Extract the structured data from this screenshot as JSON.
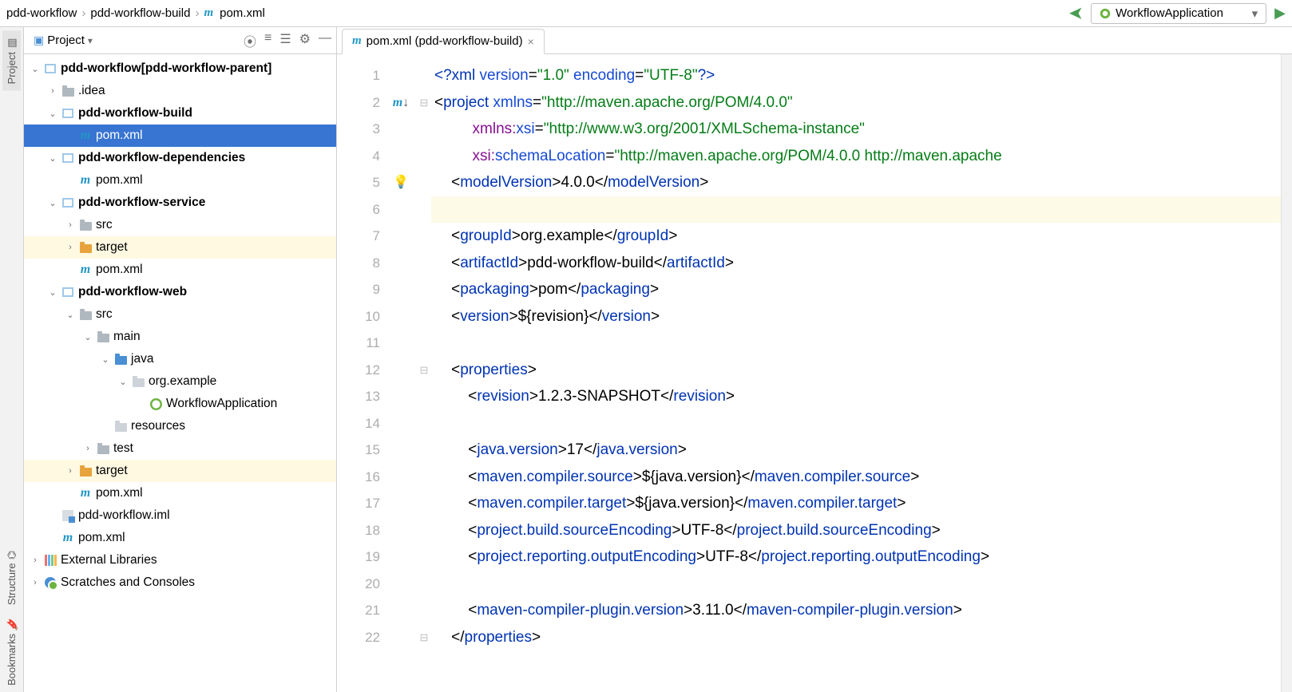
{
  "breadcrumb": [
    "pdd-workflow",
    "pdd-workflow-build",
    "pom.xml"
  ],
  "run_config": "WorkflowApplication",
  "rail": {
    "project": "Project",
    "structure": "Structure",
    "bookmarks": "Bookmarks"
  },
  "project_panel": {
    "title": "Project"
  },
  "tree": [
    {
      "d": 0,
      "tw": "v",
      "ic": "module",
      "label": "pdd-workflow",
      "suffix": " [pdd-workflow-parent]",
      "bold": true
    },
    {
      "d": 1,
      "tw": ">",
      "ic": "folder",
      "label": ".idea"
    },
    {
      "d": 1,
      "tw": "v",
      "ic": "module",
      "label": "pdd-workflow-build",
      "bold": true
    },
    {
      "d": 2,
      "tw": "",
      "ic": "maven",
      "label": "pom.xml",
      "sel": true
    },
    {
      "d": 1,
      "tw": "v",
      "ic": "module",
      "label": "pdd-workflow-dependencies",
      "bold": true
    },
    {
      "d": 2,
      "tw": "",
      "ic": "maven",
      "label": "pom.xml"
    },
    {
      "d": 1,
      "tw": "v",
      "ic": "module",
      "label": "pdd-workflow-service",
      "bold": true
    },
    {
      "d": 2,
      "tw": ">",
      "ic": "folder",
      "label": "src"
    },
    {
      "d": 2,
      "tw": ">",
      "ic": "folder-orange",
      "label": "target",
      "hl": true
    },
    {
      "d": 2,
      "tw": "",
      "ic": "maven",
      "label": "pom.xml"
    },
    {
      "d": 1,
      "tw": "v",
      "ic": "module",
      "label": "pdd-workflow-web",
      "bold": true
    },
    {
      "d": 2,
      "tw": "v",
      "ic": "folder",
      "label": "src"
    },
    {
      "d": 3,
      "tw": "v",
      "ic": "folder",
      "label": "main"
    },
    {
      "d": 4,
      "tw": "v",
      "ic": "folder-blue",
      "label": "java"
    },
    {
      "d": 5,
      "tw": "v",
      "ic": "folder-pkg",
      "label": "org.example"
    },
    {
      "d": 6,
      "tw": "",
      "ic": "java",
      "label": "WorkflowApplication"
    },
    {
      "d": 4,
      "tw": "",
      "ic": "folder-pkg",
      "label": "resources"
    },
    {
      "d": 3,
      "tw": ">",
      "ic": "folder",
      "label": "test"
    },
    {
      "d": 2,
      "tw": ">",
      "ic": "folder-orange",
      "label": "target",
      "hl": true
    },
    {
      "d": 2,
      "tw": "",
      "ic": "maven",
      "label": "pom.xml"
    },
    {
      "d": 1,
      "tw": "",
      "ic": "iml",
      "label": "pdd-workflow.iml"
    },
    {
      "d": 1,
      "tw": "",
      "ic": "maven",
      "label": "pom.xml"
    },
    {
      "d": 0,
      "tw": ">",
      "ic": "lib",
      "label": "External Libraries"
    },
    {
      "d": 0,
      "tw": ">",
      "ic": "scratch",
      "label": "Scratches and Consoles"
    }
  ],
  "tab": "pom.xml (pdd-workflow-build)",
  "lines": 22,
  "gutter_marks": {
    "2": "m↓",
    "5": "bulb"
  },
  "fold_marks": {
    "2": "⊟",
    "12": "⊟",
    "22": "⊟"
  },
  "code": [
    [
      [
        "pi",
        "<?"
      ],
      [
        "tag",
        "xml "
      ],
      [
        "attr",
        "version"
      ],
      [
        "punc",
        "="
      ],
      [
        "str",
        "\"1.0\""
      ],
      [
        "attr",
        " encoding"
      ],
      [
        "punc",
        "="
      ],
      [
        "str",
        "\"UTF-8\""
      ],
      [
        "pi",
        "?>"
      ]
    ],
    [
      [
        "punc",
        "<"
      ],
      [
        "tag",
        "project "
      ],
      [
        "attr",
        "xmlns"
      ],
      [
        "punc",
        "="
      ],
      [
        "str",
        "\"http://maven.apache.org/POM/4.0.0\""
      ]
    ],
    [
      [
        "text",
        "         "
      ],
      [
        "ns",
        "xmlns:"
      ],
      [
        "attr",
        "xsi"
      ],
      [
        "punc",
        "="
      ],
      [
        "str",
        "\"http://www.w3.org/2001/XMLSchema-instance\""
      ]
    ],
    [
      [
        "text",
        "         "
      ],
      [
        "ns",
        "xsi:"
      ],
      [
        "attr",
        "schemaLocation"
      ],
      [
        "punc",
        "="
      ],
      [
        "str",
        "\"http://maven.apache.org/POM/4.0.0 http://maven.apache"
      ]
    ],
    [
      [
        "text",
        "    "
      ],
      [
        "punc",
        "<"
      ],
      [
        "tag",
        "modelVersion"
      ],
      [
        "punc",
        ">"
      ],
      [
        "text",
        "4.0.0"
      ],
      [
        "punc",
        "</"
      ],
      [
        "tag",
        "modelVersion"
      ],
      [
        "punc",
        ">"
      ]
    ],
    [],
    [
      [
        "text",
        "    "
      ],
      [
        "punc",
        "<"
      ],
      [
        "tag",
        "groupId"
      ],
      [
        "punc",
        ">"
      ],
      [
        "text",
        "org.example"
      ],
      [
        "punc",
        "</"
      ],
      [
        "tag",
        "groupId"
      ],
      [
        "punc",
        ">"
      ]
    ],
    [
      [
        "text",
        "    "
      ],
      [
        "punc",
        "<"
      ],
      [
        "tag",
        "artifactId"
      ],
      [
        "punc",
        ">"
      ],
      [
        "text",
        "pdd-workflow-build"
      ],
      [
        "punc",
        "</"
      ],
      [
        "tag",
        "artifactId"
      ],
      [
        "punc",
        ">"
      ]
    ],
    [
      [
        "text",
        "    "
      ],
      [
        "punc",
        "<"
      ],
      [
        "tag",
        "packaging"
      ],
      [
        "punc",
        ">"
      ],
      [
        "text",
        "pom"
      ],
      [
        "punc",
        "</"
      ],
      [
        "tag",
        "packaging"
      ],
      [
        "punc",
        ">"
      ]
    ],
    [
      [
        "text",
        "    "
      ],
      [
        "punc",
        "<"
      ],
      [
        "tag",
        "version"
      ],
      [
        "punc",
        ">"
      ],
      [
        "text",
        "${revision}"
      ],
      [
        "punc",
        "</"
      ],
      [
        "tag",
        "version"
      ],
      [
        "punc",
        ">"
      ]
    ],
    [],
    [
      [
        "text",
        "    "
      ],
      [
        "punc",
        "<"
      ],
      [
        "tag",
        "properties"
      ],
      [
        "punc",
        ">"
      ]
    ],
    [
      [
        "text",
        "        "
      ],
      [
        "punc",
        "<"
      ],
      [
        "tag",
        "revision"
      ],
      [
        "punc",
        ">"
      ],
      [
        "text",
        "1.2.3-SNAPSHOT"
      ],
      [
        "punc",
        "</"
      ],
      [
        "tag",
        "revision"
      ],
      [
        "punc",
        ">"
      ]
    ],
    [],
    [
      [
        "text",
        "        "
      ],
      [
        "punc",
        "<"
      ],
      [
        "tag",
        "java.version"
      ],
      [
        "punc",
        ">"
      ],
      [
        "text",
        "17"
      ],
      [
        "punc",
        "</"
      ],
      [
        "tag",
        "java.version"
      ],
      [
        "punc",
        ">"
      ]
    ],
    [
      [
        "text",
        "        "
      ],
      [
        "punc",
        "<"
      ],
      [
        "tag",
        "maven.compiler.source"
      ],
      [
        "punc",
        ">"
      ],
      [
        "text",
        "${java.version}"
      ],
      [
        "punc",
        "</"
      ],
      [
        "tag",
        "maven.compiler.source"
      ],
      [
        "punc",
        ">"
      ]
    ],
    [
      [
        "text",
        "        "
      ],
      [
        "punc",
        "<"
      ],
      [
        "tag",
        "maven.compiler.target"
      ],
      [
        "punc",
        ">"
      ],
      [
        "text",
        "${java.version}"
      ],
      [
        "punc",
        "</"
      ],
      [
        "tag",
        "maven.compiler.target"
      ],
      [
        "punc",
        ">"
      ]
    ],
    [
      [
        "text",
        "        "
      ],
      [
        "punc",
        "<"
      ],
      [
        "tag",
        "project.build.sourceEncoding"
      ],
      [
        "punc",
        ">"
      ],
      [
        "text",
        "UTF-8"
      ],
      [
        "punc",
        "</"
      ],
      [
        "tag",
        "project.build.sourceEncoding"
      ],
      [
        "punc",
        ">"
      ]
    ],
    [
      [
        "text",
        "        "
      ],
      [
        "punc",
        "<"
      ],
      [
        "tag",
        "project.reporting.outputEncoding"
      ],
      [
        "punc",
        ">"
      ],
      [
        "text",
        "UTF-8"
      ],
      [
        "punc",
        "</"
      ],
      [
        "tag",
        "project.reporting.outputEncoding"
      ],
      [
        "punc",
        ">"
      ]
    ],
    [],
    [
      [
        "text",
        "        "
      ],
      [
        "punc",
        "<"
      ],
      [
        "tag",
        "maven-compiler-plugin.version"
      ],
      [
        "punc",
        ">"
      ],
      [
        "text",
        "3.11.0"
      ],
      [
        "punc",
        "</"
      ],
      [
        "tag",
        "maven-compiler-plugin.version"
      ],
      [
        "punc",
        ">"
      ]
    ],
    [
      [
        "text",
        "    "
      ],
      [
        "punc",
        "</"
      ],
      [
        "tag",
        "properties"
      ],
      [
        "punc",
        ">"
      ]
    ]
  ],
  "caret_line": 6
}
